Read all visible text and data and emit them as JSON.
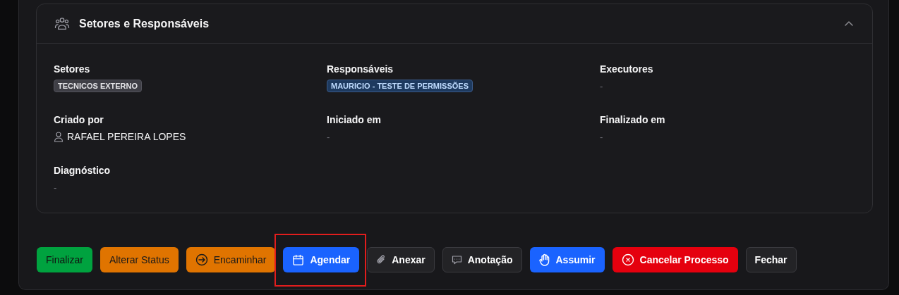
{
  "section": {
    "title": "Setores e Responsáveis",
    "expanded": true
  },
  "fields": [
    {
      "label": "Setores",
      "kind": "tag",
      "value": "TECNICOS EXTERNO",
      "color": "#3f3f46"
    },
    {
      "label": "Responsáveis",
      "kind": "tag",
      "value": "MAURICIO - TESTE DE PERMISSÕES",
      "color": "#1e3a5f"
    },
    {
      "label": "Executores",
      "kind": "empty",
      "value": "-"
    },
    {
      "label": "Criado por",
      "kind": "person",
      "value": "RAFAEL PEREIRA LOPES"
    },
    {
      "label": "Iniciado em",
      "kind": "empty",
      "value": "-"
    },
    {
      "label": "Finalizado em",
      "kind": "empty",
      "value": "-"
    },
    {
      "label": "Diagnóstico",
      "kind": "empty",
      "value": "-"
    }
  ],
  "buttons": [
    {
      "label": "Finalizar",
      "kind": "success",
      "highlighted": false
    },
    {
      "label": "Alterar Status",
      "kind": "warning",
      "highlighted": false
    },
    {
      "label": "Encaminhar",
      "kind": "warning",
      "highlighted": false
    },
    {
      "label": "Agendar",
      "kind": "primary",
      "highlighted": true
    },
    {
      "label": "Anexar",
      "kind": "outline",
      "highlighted": false
    },
    {
      "label": "Anotação",
      "kind": "outline",
      "highlighted": false
    },
    {
      "label": "Assumir",
      "kind": "primary",
      "highlighted": false
    },
    {
      "label": "Cancelar Processo",
      "kind": "danger",
      "highlighted": false
    },
    {
      "label": "Fechar",
      "kind": "outline",
      "highlighted": false
    }
  ]
}
